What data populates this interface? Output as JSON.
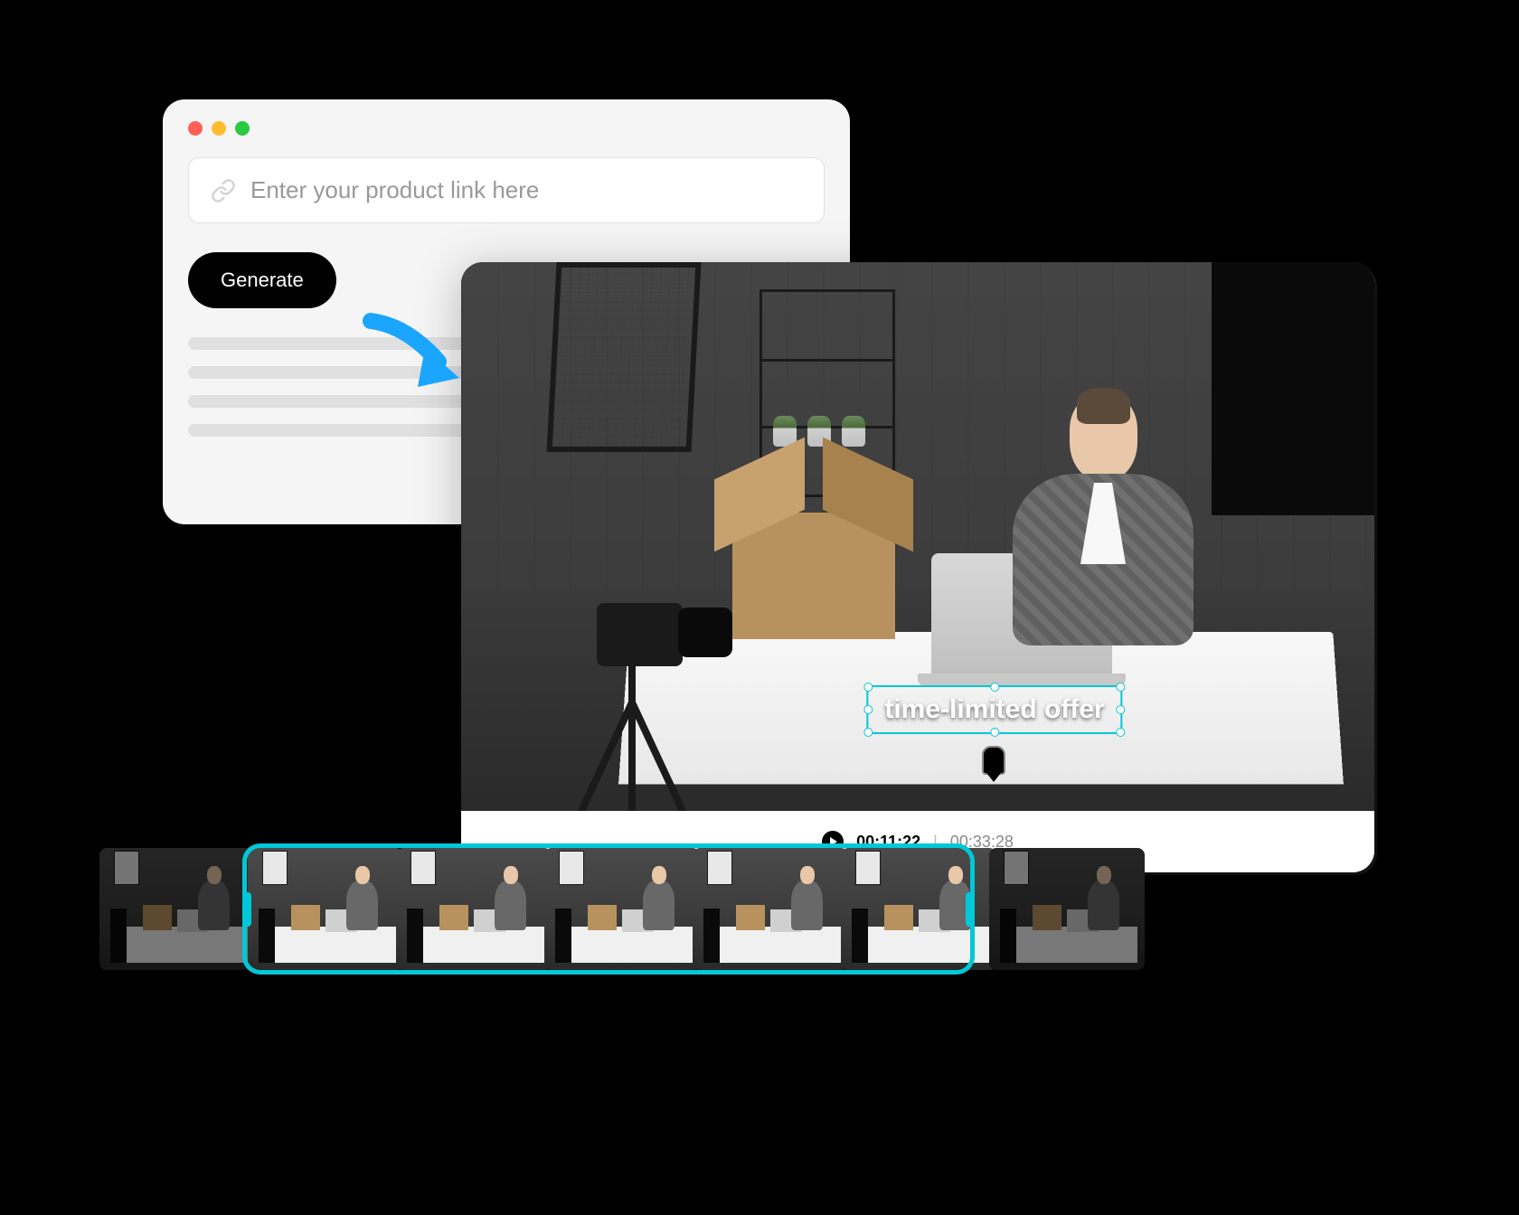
{
  "input_card": {
    "url_placeholder": "Enter your product link here",
    "generate_button": "Generate"
  },
  "video": {
    "caption": "time-limited offer",
    "current_time": "00:11:22",
    "total_time": "00:33:28"
  },
  "colors": {
    "accent": "#00c8d8",
    "arrow": "#1aa5ff"
  }
}
